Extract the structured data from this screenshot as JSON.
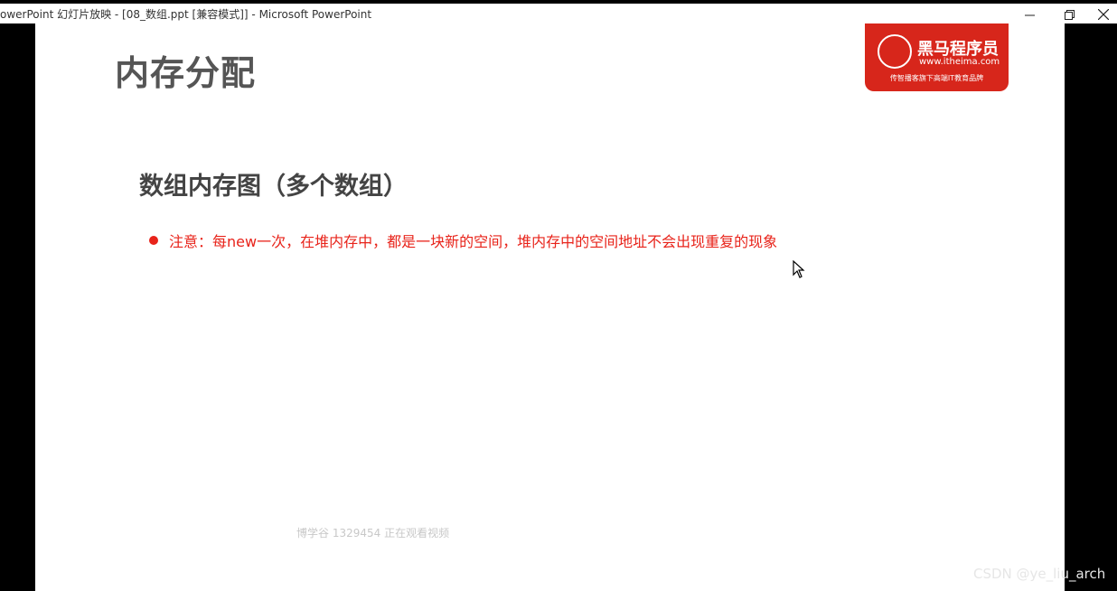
{
  "window": {
    "title": "owerPoint 幻灯片放映 - [08_数组.ppt [兼容模式]] - Microsoft PowerPoint",
    "minimize_icon": "minimize-icon",
    "restore_icon": "restore-icon",
    "close_icon": "close-icon"
  },
  "slide": {
    "title": "内存分配",
    "logo": {
      "brand": "黑马程序员",
      "url": "www.itheima.com",
      "tagline": "传智播客旗下高端IT教育品牌"
    },
    "subtitle": "数组内存图（多个数组）",
    "bullets": [
      "注意：每new一次，在堆内存中，都是一块新的空间，堆内存中的空间地址不会出现重复的现象"
    ],
    "watermark": "博学谷 1329454 正在观看视频"
  },
  "overlay": {
    "csdn_watermark": "CSDN @ye_liu_arch"
  },
  "colors": {
    "accent_red": "#e8231a",
    "logo_red": "#d7261b",
    "title_gray": "#555555"
  }
}
